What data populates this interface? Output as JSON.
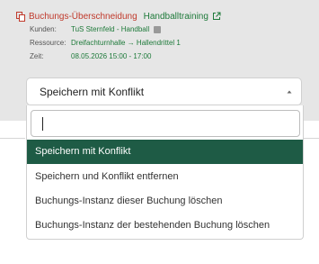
{
  "conflict": {
    "type_label": "Buchungs-Überschneidung",
    "booking_name": "Handballtraining",
    "details": [
      {
        "label": "Kunden:",
        "value": "TuS Sternfeld - Handball"
      },
      {
        "label": "Ressource:",
        "value": "Dreifachturnhalle → Hallendrittel 1"
      },
      {
        "label": "Zeit:",
        "value": "08.05.2026 15:00 - 17:00"
      }
    ]
  },
  "select": {
    "value": "Speichern mit Konflikt",
    "search_value": "",
    "options": [
      {
        "label": "Speichern mit Konflikt",
        "active": true
      },
      {
        "label": "Speichern und Konflikt entfernen",
        "active": false
      },
      {
        "label": "Buchungs-Instanz dieser Buchung löschen",
        "active": false
      },
      {
        "label": "Buchungs-Instanz der bestehenden Buchung löschen",
        "active": false
      }
    ]
  },
  "colors": {
    "conflict_red": "#c0392b",
    "link_green": "#1e7a3a",
    "active_option_bg": "#1e5b45",
    "panel_bg": "#e6e6e6"
  },
  "icons": {
    "conflict": "overlap-squares-icon",
    "external_link": "external-link-icon",
    "tag": "tag-icon",
    "caret": "caret-up-icon"
  }
}
